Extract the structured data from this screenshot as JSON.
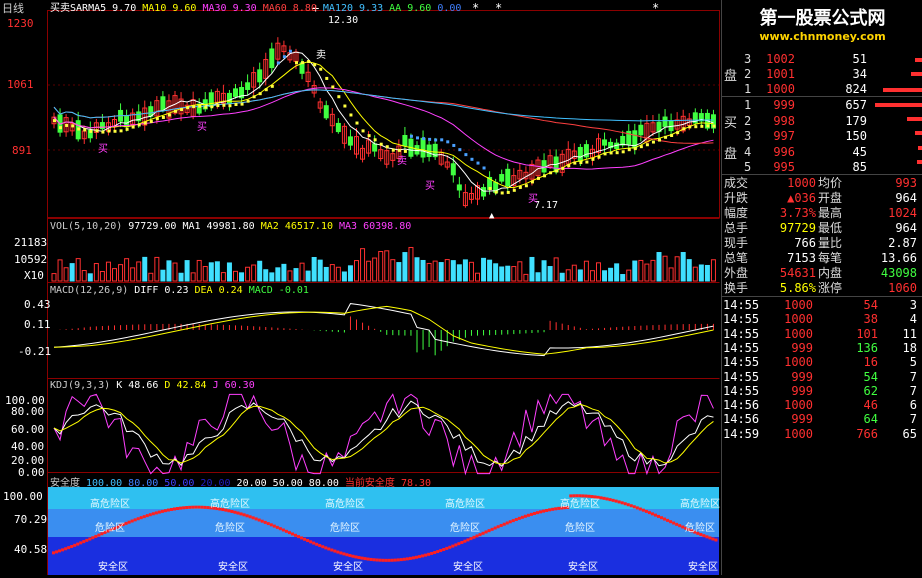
{
  "top_left_label": "日线",
  "price_axis": [
    "1230",
    "1061",
    "891"
  ],
  "indicator_headers": {
    "main": {
      "name": "买卖SAR",
      "items": [
        {
          "t": "MA5 9.70",
          "c": "#ffffff"
        },
        {
          "t": "MA10 9.60",
          "c": "#ffff00"
        },
        {
          "t": "MA30 9.30",
          "c": "#ff40ff"
        },
        {
          "t": "MA60 8.80",
          "c": "#ff4040"
        },
        {
          "t": "MA120 9.33",
          "c": "#40c0ff"
        },
        {
          "t": "AA 9.60",
          "c": "#40ff40"
        },
        {
          "t": "0.00",
          "c": "#4080ff"
        }
      ]
    },
    "vol": [
      {
        "t": "VOL(5,10,20)",
        "c": "#cccccc"
      },
      {
        "t": "97729.00",
        "c": "#ffffff"
      },
      {
        "t": "MA1 49981.80",
        "c": "#ffffff"
      },
      {
        "t": "MA2 46517.10",
        "c": "#ffff00"
      },
      {
        "t": "MA3 60398.80",
        "c": "#ff40ff"
      }
    ],
    "macd": [
      {
        "t": "MACD(12,26,9)",
        "c": "#cccccc"
      },
      {
        "t": "DIFF 0.23",
        "c": "#ffffff"
      },
      {
        "t": "DEA 0.24",
        "c": "#ffff00"
      },
      {
        "t": "MACD -0.01",
        "c": "#40ff40"
      }
    ],
    "kdj": [
      {
        "t": "KDJ(9,3,3)",
        "c": "#cccccc"
      },
      {
        "t": "K 48.66",
        "c": "#ffffff"
      },
      {
        "t": "D 42.84",
        "c": "#ffff00"
      },
      {
        "t": "J 60.30",
        "c": "#ff40ff"
      }
    ],
    "safe": [
      {
        "t": "安全度",
        "c": "#cccccc"
      },
      {
        "t": "100.00",
        "c": "#40c0ff"
      },
      {
        "t": "80.00",
        "c": "#4080ff"
      },
      {
        "t": "50.00",
        "c": "#4040ff"
      },
      {
        "t": "20.00",
        "c": "#2020c0"
      },
      {
        "t": "20.00",
        "c": "#ffffff"
      },
      {
        "t": "50.00",
        "c": "#ffffff"
      },
      {
        "t": "80.00",
        "c": "#ffffff"
      },
      {
        "t": "当前安全度 78.30",
        "c": "#ff3030"
      }
    ]
  },
  "price_annotations": {
    "high": "12.30",
    "low": "7.17"
  },
  "buy_sell": {
    "buy": "买",
    "sell": "卖"
  },
  "vol_axis": [
    "21183",
    "10592",
    "X10"
  ],
  "macd_axis": [
    "0.43",
    "0.11",
    "-0.21"
  ],
  "kdj_axis": [
    "100.00",
    "80.00",
    "60.00",
    "40.00",
    "20.00",
    "0.00"
  ],
  "safe_axis": [
    "100.00",
    "70.29",
    "40.58"
  ],
  "zones": {
    "high": "高危险区",
    "mid": "危险区",
    "safe": "安全区"
  },
  "banner": {
    "title": "第一股票公式网",
    "url": "www.chnmoney.com"
  },
  "sell_side_label": "盘",
  "buy_side_label": [
    "买",
    "盘"
  ],
  "asks": [
    {
      "n": "3",
      "p": "1002",
      "v": "51"
    },
    {
      "n": "2",
      "p": "1001",
      "v": "34"
    },
    {
      "n": "1",
      "p": "1000",
      "v": "824"
    }
  ],
  "bids": [
    {
      "n": "1",
      "p": "999",
      "v": "657"
    },
    {
      "n": "2",
      "p": "998",
      "v": "179"
    },
    {
      "n": "3",
      "p": "997",
      "v": "150"
    },
    {
      "n": "4",
      "p": "996",
      "v": "45"
    },
    {
      "n": "5",
      "p": "995",
      "v": "85"
    }
  ],
  "stats": [
    {
      "l1": "成交",
      "v1": "1000",
      "c1": "#ff3030",
      "l2": "均价",
      "v2": "993",
      "c2": "#ff3030"
    },
    {
      "l1": "升跌",
      "v1": "▲036",
      "c1": "#ff3030",
      "l2": "开盘",
      "v2": "964",
      "c2": "#ffffff"
    },
    {
      "l1": "幅度",
      "v1": "3.73%",
      "c1": "#ff3030",
      "l2": "最高",
      "v2": "1024",
      "c2": "#ff3030"
    },
    {
      "l1": "总手",
      "v1": "97729",
      "c1": "#ffff00",
      "l2": "最低",
      "v2": "964",
      "c2": "#ffffff"
    },
    {
      "l1": "现手",
      "v1": "766",
      "c1": "#ffffff",
      "l2": "量比",
      "v2": "2.87",
      "c2": "#ffffff"
    },
    {
      "l1": "总笔",
      "v1": "7153",
      "c1": "#ffffff",
      "l2": "每笔",
      "v2": "13.66",
      "c2": "#ffffff"
    },
    {
      "l1": "外盘",
      "v1": "54631",
      "c1": "#ff3030",
      "l2": "内盘",
      "v2": "43098",
      "c2": "#40ff40"
    },
    {
      "l1": "换手",
      "v1": "5.86%",
      "c1": "#ffff00",
      "l2": "涨停",
      "v2": "1060",
      "c2": "#ff3030"
    }
  ],
  "ticks": [
    {
      "t": "14:55",
      "p": "1000",
      "pc": "#ff3030",
      "v": "54",
      "vc": "#ff3030",
      "n": "3"
    },
    {
      "t": "14:55",
      "p": "1000",
      "pc": "#ff3030",
      "v": "38",
      "vc": "#ff3030",
      "n": "4"
    },
    {
      "t": "14:55",
      "p": "1000",
      "pc": "#ff3030",
      "v": "101",
      "vc": "#ff3030",
      "n": "11"
    },
    {
      "t": "14:55",
      "p": "999",
      "pc": "#ff3030",
      "v": "136",
      "vc": "#40ff40",
      "n": "18"
    },
    {
      "t": "14:55",
      "p": "1000",
      "pc": "#ff3030",
      "v": "16",
      "vc": "#ff3030",
      "n": "5"
    },
    {
      "t": "14:55",
      "p": "999",
      "pc": "#ff3030",
      "v": "54",
      "vc": "#40ff40",
      "n": "7"
    },
    {
      "t": "14:55",
      "p": "999",
      "pc": "#ff3030",
      "v": "62",
      "vc": "#40ff40",
      "n": "7"
    },
    {
      "t": "14:56",
      "p": "1000",
      "pc": "#ff3030",
      "v": "46",
      "vc": "#ff3030",
      "n": "6"
    },
    {
      "t": "14:56",
      "p": "999",
      "pc": "#ff3030",
      "v": "64",
      "vc": "#40ff40",
      "n": "7"
    },
    {
      "t": "14:59",
      "p": "1000",
      "pc": "#ff3030",
      "v": "766",
      "vc": "#ff3030",
      "n": "65"
    }
  ]
}
